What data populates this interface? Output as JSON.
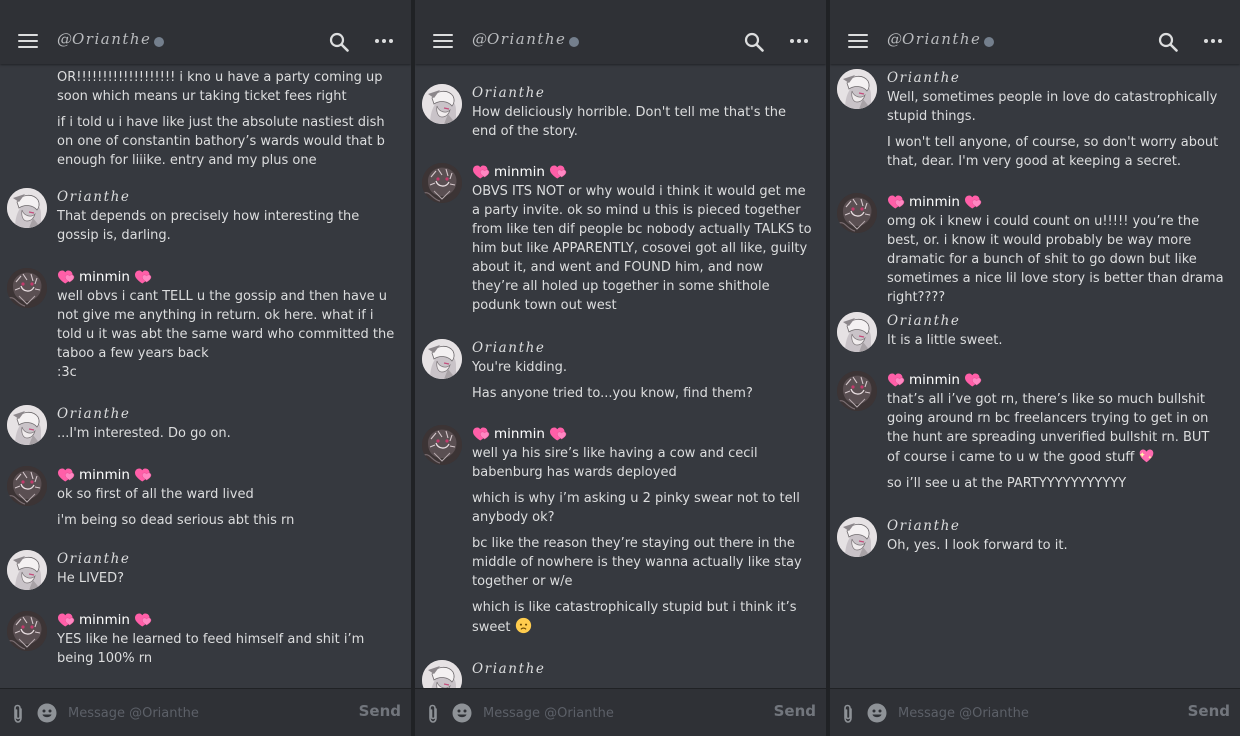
{
  "header": {
    "at": "@",
    "name": "Orianthe"
  },
  "composer": {
    "placeholder": "Message @Orianthe",
    "send_label": "Send"
  },
  "users": {
    "minmin": "minmin",
    "orianthe": "Orianthe"
  },
  "panels": [
    {
      "groups": [
        {
          "author": "",
          "lines": [
            "OR!!!!!!!!!!!!!!!!!!! i kno u have a party coming up soon which means ur taking ticket fees right",
            "if i told u i have like just the absolute nastiest dish on one of constantin bathory’s wards would that b enough for liiike. entry and my plus one"
          ]
        },
        {
          "author": "Orianthe",
          "lines": [
            "That depends on precisely how interesting the gossip is, darling."
          ]
        },
        {
          "author": "minmin",
          "lines": [
            "well obvs i cant TELL u the gossip and then have u not give me anything in return. ok here. what if i told u it was abt the same ward who committed the taboo a few years back\n:3c"
          ]
        },
        {
          "author": "Orianthe",
          "lines": [
            "...I'm interested. Do go on."
          ]
        },
        {
          "author": "minmin",
          "lines": [
            "ok so first of all the ward lived",
            "i'm being so dead serious abt this rn"
          ]
        },
        {
          "author": "Orianthe",
          "lines": [
            "He LIVED?"
          ]
        },
        {
          "author": "minmin",
          "lines": [
            "YES like he learned to feed himself and shit i’m being 100% rn"
          ]
        }
      ]
    },
    {
      "groups": [
        {
          "author": "Orianthe",
          "lines": [
            "How deliciously horrible. Don't tell me that's the end of the story."
          ]
        },
        {
          "author": "minmin",
          "lines": [
            "OBVS ITS NOT or why would i think it would get me a party invite. ok so mind u this is pieced together from like ten dif people bc nobody actually TALKS to him but like APPARENTLY, cosovei got all like, guilty about it, and went and FOUND him, and now they’re all holed up together in some shithole podunk town out west"
          ]
        },
        {
          "author": "Orianthe",
          "lines": [
            "You're kidding.",
            "Has anyone tried to...you know, find them?"
          ]
        },
        {
          "author": "minmin",
          "lines": [
            "well ya his sire’s like having a cow and cecil babenburg has wards deployed",
            "which is why i’m asking u 2 pinky swear not to tell anybody ok?",
            "bc like the reason they’re staying out there in the middle of nowhere is they wanna actually like stay together or w/e",
            "which is like catastrophically stupid but i think it’s sweet"
          ]
        },
        {
          "author": "Orianthe",
          "lines": []
        }
      ]
    },
    {
      "groups": [
        {
          "author": "Orianthe",
          "lines": [
            "Well, sometimes people in love do catastrophically stupid things.",
            "I won't tell anyone, of course, so don't worry about that, dear. I'm very good at keeping a secret."
          ]
        },
        {
          "author": "minmin",
          "lines": [
            "omg ok i knew i could count on u!!!!! you’re the best, or. i know it would probably be way more dramatic for a bunch of shit to go down but like sometimes a nice lil love story is better than drama right????"
          ]
        },
        {
          "author": "Orianthe",
          "lines": [
            "It is a little sweet."
          ]
        },
        {
          "author": "minmin",
          "lines": [
            "that’s all i’ve got rn, there’s like so much bullshit going around rn bc freelancers trying to get in on the hunt are spreading unverified bullshit rn. BUT of course i came to u w the good stuff",
            "so i’ll see u at the PARTYYYYYYYYYYY"
          ]
        },
        {
          "author": "Orianthe",
          "lines": [
            "Oh, yes. I look forward to it."
          ]
        }
      ]
    }
  ]
}
